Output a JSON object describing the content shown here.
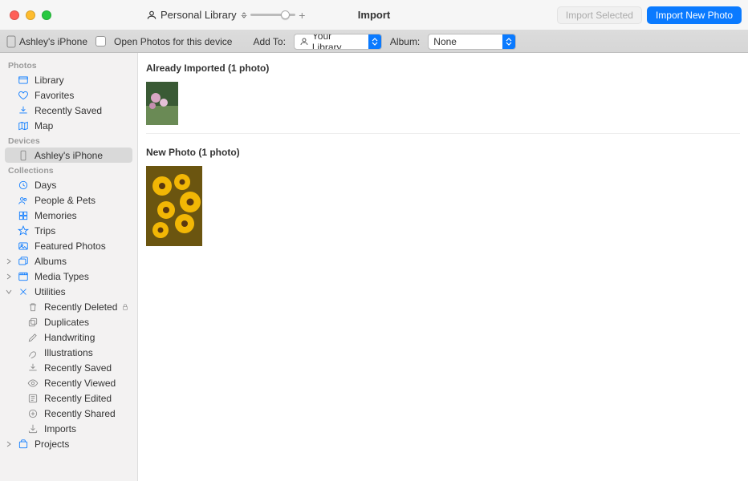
{
  "title": "Import",
  "library_label": "Personal Library",
  "toolbar": {
    "import_selected": "Import Selected",
    "import_new": "Import New Photo"
  },
  "subbar": {
    "device": "Ashley's iPhone",
    "open_photos": "Open Photos for this device",
    "add_to": "Add To:",
    "add_to_value": "Your Library",
    "album": "Album:",
    "album_value": "None"
  },
  "sidebar": {
    "photos": "Photos",
    "devices": "Devices",
    "collections": "Collections",
    "items": {
      "library": "Library",
      "favorites": "Favorites",
      "recently_saved": "Recently Saved",
      "map": "Map",
      "ashleys_iphone": "Ashley's iPhone",
      "days": "Days",
      "people_pets": "People & Pets",
      "memories": "Memories",
      "trips": "Trips",
      "featured": "Featured Photos",
      "albums": "Albums",
      "media_types": "Media Types",
      "utilities": "Utilities",
      "recently_deleted": "Recently Deleted",
      "duplicates": "Duplicates",
      "handwriting": "Handwriting",
      "illustrations": "Illustrations",
      "recently_saved2": "Recently Saved",
      "recently_viewed": "Recently Viewed",
      "recently_edited": "Recently Edited",
      "recently_shared": "Recently Shared",
      "imports": "Imports",
      "projects": "Projects"
    }
  },
  "content": {
    "already": "Already Imported (1 photo)",
    "new": "New Photo (1 photo)"
  }
}
